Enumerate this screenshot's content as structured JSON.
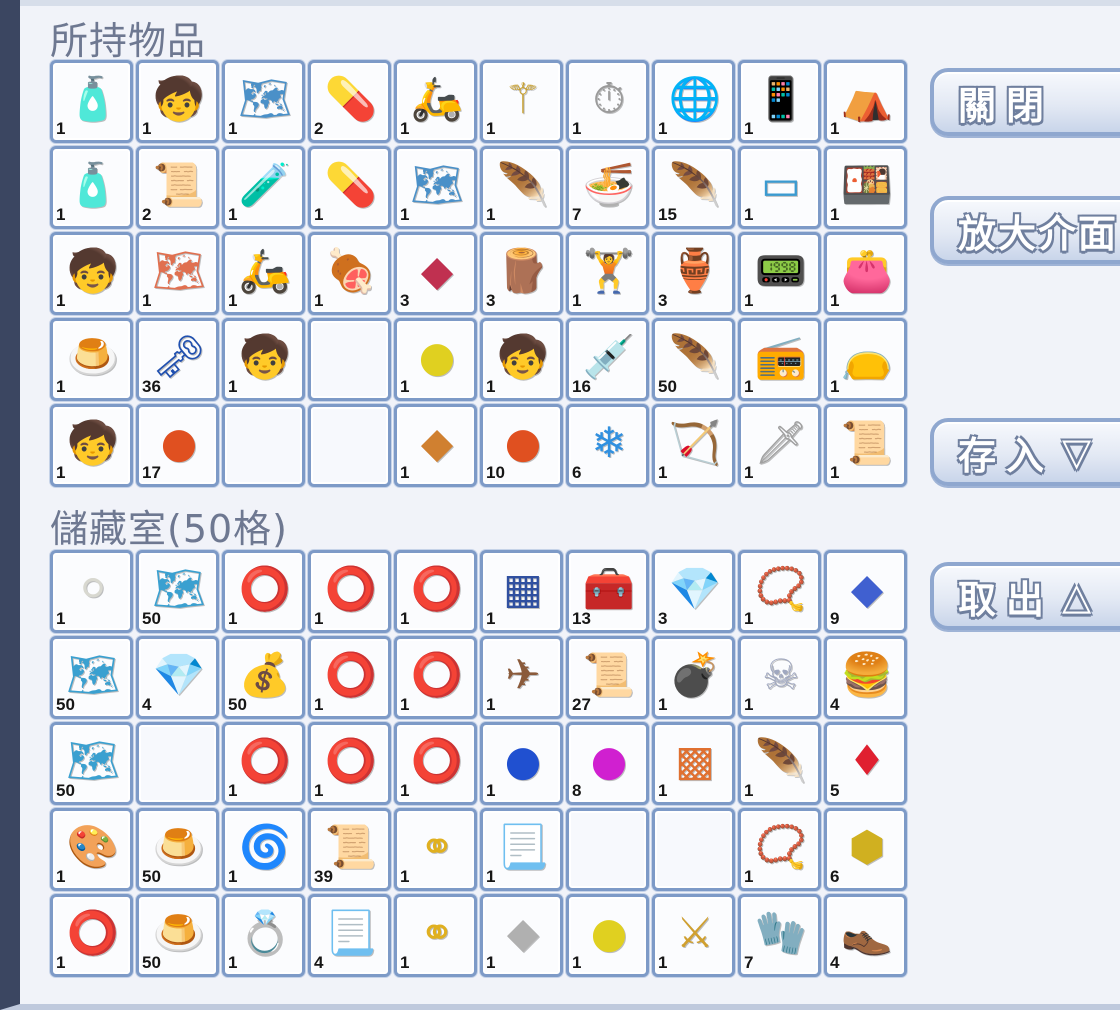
{
  "inventory": {
    "title": "所持物品",
    "slots": [
      {
        "icon": "potion-blue-icon",
        "glyph": "🧴",
        "color": "#7fb8e8",
        "count": "1"
      },
      {
        "icon": "kart-figure-icon",
        "glyph": "🧒",
        "color": "#e6a040",
        "count": "1"
      },
      {
        "icon": "map-ticket-icon",
        "glyph": "🗺",
        "color": "#4a90c8",
        "count": "1"
      },
      {
        "icon": "gray-capsule-icon",
        "glyph": "💊",
        "color": "#8a8a8a",
        "count": "2"
      },
      {
        "icon": "scooter-icon",
        "glyph": "🛵",
        "color": "#3cc6c0",
        "count": "1"
      },
      {
        "icon": "golden-staff-icon",
        "glyph": "⚚",
        "color": "#c8a030",
        "count": "1"
      },
      {
        "icon": "stopwatch-icon",
        "glyph": "⏱",
        "color": "#9a9a9a",
        "count": "1"
      },
      {
        "icon": "mecha-globe-icon",
        "glyph": "🌐",
        "color": "#4a6fb0",
        "count": "1"
      },
      {
        "icon": "remote-control-icon",
        "glyph": "📱",
        "color": "#333333",
        "count": "1"
      },
      {
        "icon": "blue-tent-icon",
        "glyph": "⛺",
        "color": "#3f5ea8",
        "count": "1"
      },
      {
        "icon": "potion-pink-icon",
        "glyph": "🧴",
        "color": "#f0a0a8",
        "count": "1"
      },
      {
        "icon": "gold-scroll-icon",
        "glyph": "📜",
        "color": "#d4a63a",
        "count": "2"
      },
      {
        "icon": "yellow-potion-icon",
        "glyph": "🧪",
        "color": "#b8b030",
        "count": "1"
      },
      {
        "icon": "red-capsule-icon",
        "glyph": "💊",
        "color": "#e04040",
        "count": "1"
      },
      {
        "icon": "map-ticket-icon",
        "glyph": "🗺",
        "color": "#4a90c8",
        "count": "1"
      },
      {
        "icon": "rainbow-wings-icon",
        "glyph": "🪶",
        "color": "#e05030",
        "count": "1"
      },
      {
        "icon": "noodle-bowl-icon",
        "glyph": "🍜",
        "color": "#a05030",
        "count": "7"
      },
      {
        "icon": "phoenix-feather-icon",
        "glyph": "🪶",
        "color": "#d03040",
        "count": "15"
      },
      {
        "icon": "blue-pad-icon",
        "glyph": "▭",
        "color": "#3a9ad0",
        "count": "1"
      },
      {
        "icon": "lunch-box-icon",
        "glyph": "🍱",
        "color": "#3a8a40",
        "count": "1"
      },
      {
        "icon": "kart-figure-icon",
        "glyph": "🧒",
        "color": "#e6a040",
        "count": "1"
      },
      {
        "icon": "treasure-map-icon",
        "glyph": "🗺",
        "color": "#e07050",
        "count": "1"
      },
      {
        "icon": "scooter-icon",
        "glyph": "🛵",
        "color": "#3cc6c0",
        "count": "1"
      },
      {
        "icon": "meat-icon",
        "glyph": "🍖",
        "color": "#b06030",
        "count": "1"
      },
      {
        "icon": "red-gem-shard-icon",
        "glyph": "◆",
        "color": "#c03050",
        "count": "3"
      },
      {
        "icon": "logs-icon",
        "glyph": "🪵",
        "color": "#c09040",
        "count": "3"
      },
      {
        "icon": "10t-weight-icon",
        "glyph": "🏋",
        "color": "#555555",
        "count": "1"
      },
      {
        "icon": "jar-icon",
        "glyph": "🏺",
        "color": "#8a5a30",
        "count": "3"
      },
      {
        "icon": "handheld-device-icon",
        "glyph": "📟",
        "color": "#333333",
        "count": "1"
      },
      {
        "icon": "pink-purse-icon",
        "glyph": "👛",
        "color": "#d04080",
        "count": "1"
      },
      {
        "icon": "purple-jelly-icon",
        "glyph": "🍮",
        "color": "#b040d0",
        "count": "1"
      },
      {
        "icon": "blue-key-icon",
        "glyph": "🗝",
        "color": "#2050b0",
        "count": "36"
      },
      {
        "icon": "kart-figure-icon",
        "glyph": "🧒",
        "color": "#e6a040",
        "count": "1"
      },
      {
        "icon": "",
        "glyph": "",
        "color": "",
        "count": ""
      },
      {
        "icon": "yellow-pearls-icon",
        "glyph": "●",
        "color": "#e0d020",
        "count": "1"
      },
      {
        "icon": "kart-figure-icon",
        "glyph": "🧒",
        "color": "#e6a040",
        "count": "1"
      },
      {
        "icon": "syringe-icon",
        "glyph": "💉",
        "color": "#c04030",
        "count": "16"
      },
      {
        "icon": "phoenix-feather-icon",
        "glyph": "🪶",
        "color": "#d03040",
        "count": "50"
      },
      {
        "icon": "walkie-talkie-icon",
        "glyph": "📻",
        "color": "#222222",
        "count": "1"
      },
      {
        "icon": "waist-bag-icon",
        "glyph": "👝",
        "color": "#5070b0",
        "count": "1"
      },
      {
        "icon": "kart-figure-icon",
        "glyph": "🧒",
        "color": "#e6a040",
        "count": "1"
      },
      {
        "icon": "red-beads-icon",
        "glyph": "●",
        "color": "#e05020",
        "count": "17"
      },
      {
        "icon": "",
        "glyph": "",
        "color": "",
        "count": ""
      },
      {
        "icon": "",
        "glyph": "",
        "color": "",
        "count": ""
      },
      {
        "icon": "orange-crystal-icon",
        "glyph": "◆",
        "color": "#d08030",
        "count": "1"
      },
      {
        "icon": "red-beads-icon",
        "glyph": "●",
        "color": "#e05020",
        "count": "10"
      },
      {
        "icon": "snowflake-orb-icon",
        "glyph": "❄",
        "color": "#3090e0",
        "count": "6"
      },
      {
        "icon": "bow-icon",
        "glyph": "🏹",
        "color": "#8060b0",
        "count": "1"
      },
      {
        "icon": "katana-icon",
        "glyph": "🗡",
        "color": "#a0a0a0",
        "count": "1"
      },
      {
        "icon": "gold-scroll-banner-icon",
        "glyph": "📜",
        "color": "#c0a040",
        "count": "1"
      }
    ]
  },
  "storage": {
    "title": "儲藏室(50格)",
    "slots": [
      {
        "icon": "white-pearl-icon",
        "glyph": "⚪",
        "color": "#d8d8d0",
        "count": "1"
      },
      {
        "icon": "map-ticket-icon",
        "glyph": "🗺",
        "color": "#3aa0d0",
        "count": "50"
      },
      {
        "icon": "leopard-band-icon",
        "glyph": "⭕",
        "color": "#8a5a2a",
        "count": "1"
      },
      {
        "icon": "leopard-band-icon",
        "glyph": "⭕",
        "color": "#8a5a2a",
        "count": "1"
      },
      {
        "icon": "gold-band-icon",
        "glyph": "⭕",
        "color": "#d0a020",
        "count": "1"
      },
      {
        "icon": "blue-carpet-icon",
        "glyph": "▦",
        "color": "#3050a0",
        "count": "1"
      },
      {
        "icon": "purple-chest-icon",
        "glyph": "🧰",
        "color": "#6030a0",
        "count": "13"
      },
      {
        "icon": "yellow-diamond-icon",
        "glyph": "💎",
        "color": "#e0c020",
        "count": "3"
      },
      {
        "icon": "necklace-icon",
        "glyph": "📿",
        "color": "#c04030",
        "count": "1"
      },
      {
        "icon": "blue-crystal-icon",
        "glyph": "◆",
        "color": "#4060d0",
        "count": "9"
      },
      {
        "icon": "map-ticket-icon",
        "glyph": "🗺",
        "color": "#3aa0d0",
        "count": "50"
      },
      {
        "icon": "purple-gem-icon",
        "glyph": "💎",
        "color": "#7030b0",
        "count": "4"
      },
      {
        "icon": "coin-bag-icon",
        "glyph": "💰",
        "color": "#6040a0",
        "count": "50"
      },
      {
        "icon": "teal-band-icon",
        "glyph": "⭕",
        "color": "#40a0b0",
        "count": "1"
      },
      {
        "icon": "gold-band-icon",
        "glyph": "⭕",
        "color": "#d0a020",
        "count": "1"
      },
      {
        "icon": "biplane-icon",
        "glyph": "✈",
        "color": "#8a5a3a",
        "count": "1"
      },
      {
        "icon": "gold-scroll-icon",
        "glyph": "📜",
        "color": "#d4a63a",
        "count": "27"
      },
      {
        "icon": "cannon-icon",
        "glyph": "💣",
        "color": "#b03030",
        "count": "1"
      },
      {
        "icon": "silver-skull-wings-icon",
        "glyph": "☠",
        "color": "#a0a8c0",
        "count": "1"
      },
      {
        "icon": "burger-box-icon",
        "glyph": "🍔",
        "color": "#6a4a2a",
        "count": "4"
      },
      {
        "icon": "map-ticket-icon",
        "glyph": "🗺",
        "color": "#3aa0d0",
        "count": "50"
      },
      {
        "icon": "",
        "glyph": "",
        "color": "",
        "count": ""
      },
      {
        "icon": "teal-band-icon",
        "glyph": "⭕",
        "color": "#40a0b0",
        "count": "1"
      },
      {
        "icon": "gold-band-icon",
        "glyph": "⭕",
        "color": "#d0a020",
        "count": "1"
      },
      {
        "icon": "gold-band-icon",
        "glyph": "⭕",
        "color": "#d0a020",
        "count": "1"
      },
      {
        "icon": "blue-pearls-icon",
        "glyph": "●",
        "color": "#2050d0",
        "count": "1"
      },
      {
        "icon": "magenta-pearls-icon",
        "glyph": "●",
        "color": "#d020d0",
        "count": "8"
      },
      {
        "icon": "orange-cloth-icon",
        "glyph": "▩",
        "color": "#e07030",
        "count": "1"
      },
      {
        "icon": "rainbow-wings-icon",
        "glyph": "🪶",
        "color": "#e05030",
        "count": "1"
      },
      {
        "icon": "red-gem-icon",
        "glyph": "♦",
        "color": "#e02030",
        "count": "5"
      },
      {
        "icon": "paint-kit-icon",
        "glyph": "🎨",
        "color": "#2a70b0",
        "count": "1"
      },
      {
        "icon": "purple-jelly-icon",
        "glyph": "🍮",
        "color": "#b040d0",
        "count": "50"
      },
      {
        "icon": "bronze-coil-icon",
        "glyph": "🌀",
        "color": "#8a6020",
        "count": "1"
      },
      {
        "icon": "gold-scroll-icon",
        "glyph": "📜",
        "color": "#d4a63a",
        "count": "39"
      },
      {
        "icon": "gold-rings-icon",
        "glyph": "⚭",
        "color": "#e0b020",
        "count": "1"
      },
      {
        "icon": "parchment-icon",
        "glyph": "📃",
        "color": "#d0b070",
        "count": "1"
      },
      {
        "icon": "",
        "glyph": "",
        "color": "",
        "count": ""
      },
      {
        "icon": "",
        "glyph": "",
        "color": "",
        "count": ""
      },
      {
        "icon": "bead-necklace-icon",
        "glyph": "📿",
        "color": "#3060a0",
        "count": "1"
      },
      {
        "icon": "gold-gem-icon",
        "glyph": "⬢",
        "color": "#d0b020",
        "count": "6"
      },
      {
        "icon": "wooden-ring-icon",
        "glyph": "⭕",
        "color": "#8a5030",
        "count": "1"
      },
      {
        "icon": "purple-jelly-icon",
        "glyph": "🍮",
        "color": "#b040d0",
        "count": "50"
      },
      {
        "icon": "silver-ring-icon",
        "glyph": "💍",
        "color": "#c0c0c0",
        "count": "1"
      },
      {
        "icon": "parchment-icon",
        "glyph": "📃",
        "color": "#d0b070",
        "count": "4"
      },
      {
        "icon": "gold-rings-icon",
        "glyph": "⚭",
        "color": "#e0b020",
        "count": "1"
      },
      {
        "icon": "white-crystal-icon",
        "glyph": "◆",
        "color": "#b0b0b0",
        "count": "1"
      },
      {
        "icon": "yellow-pearls-icon",
        "glyph": "●",
        "color": "#e0d020",
        "count": "1"
      },
      {
        "icon": "gold-sword-icon",
        "glyph": "⚔",
        "color": "#d0a030",
        "count": "1"
      },
      {
        "icon": "white-glove-icon",
        "glyph": "🧤",
        "color": "#c8d0c8",
        "count": "7"
      },
      {
        "icon": "brown-shoes-icon",
        "glyph": "👞",
        "color": "#6a4a30",
        "count": "4"
      }
    ]
  },
  "buttons": {
    "close": "關閉",
    "enlarge": "放大介面",
    "deposit": "存入",
    "deposit_arrow": "▽",
    "withdraw": "取出",
    "withdraw_arrow": "△"
  },
  "colors": {
    "slot_border": "#7d9ac7",
    "title_text": "#6e7891",
    "button_border": "#8fa7cf"
  }
}
